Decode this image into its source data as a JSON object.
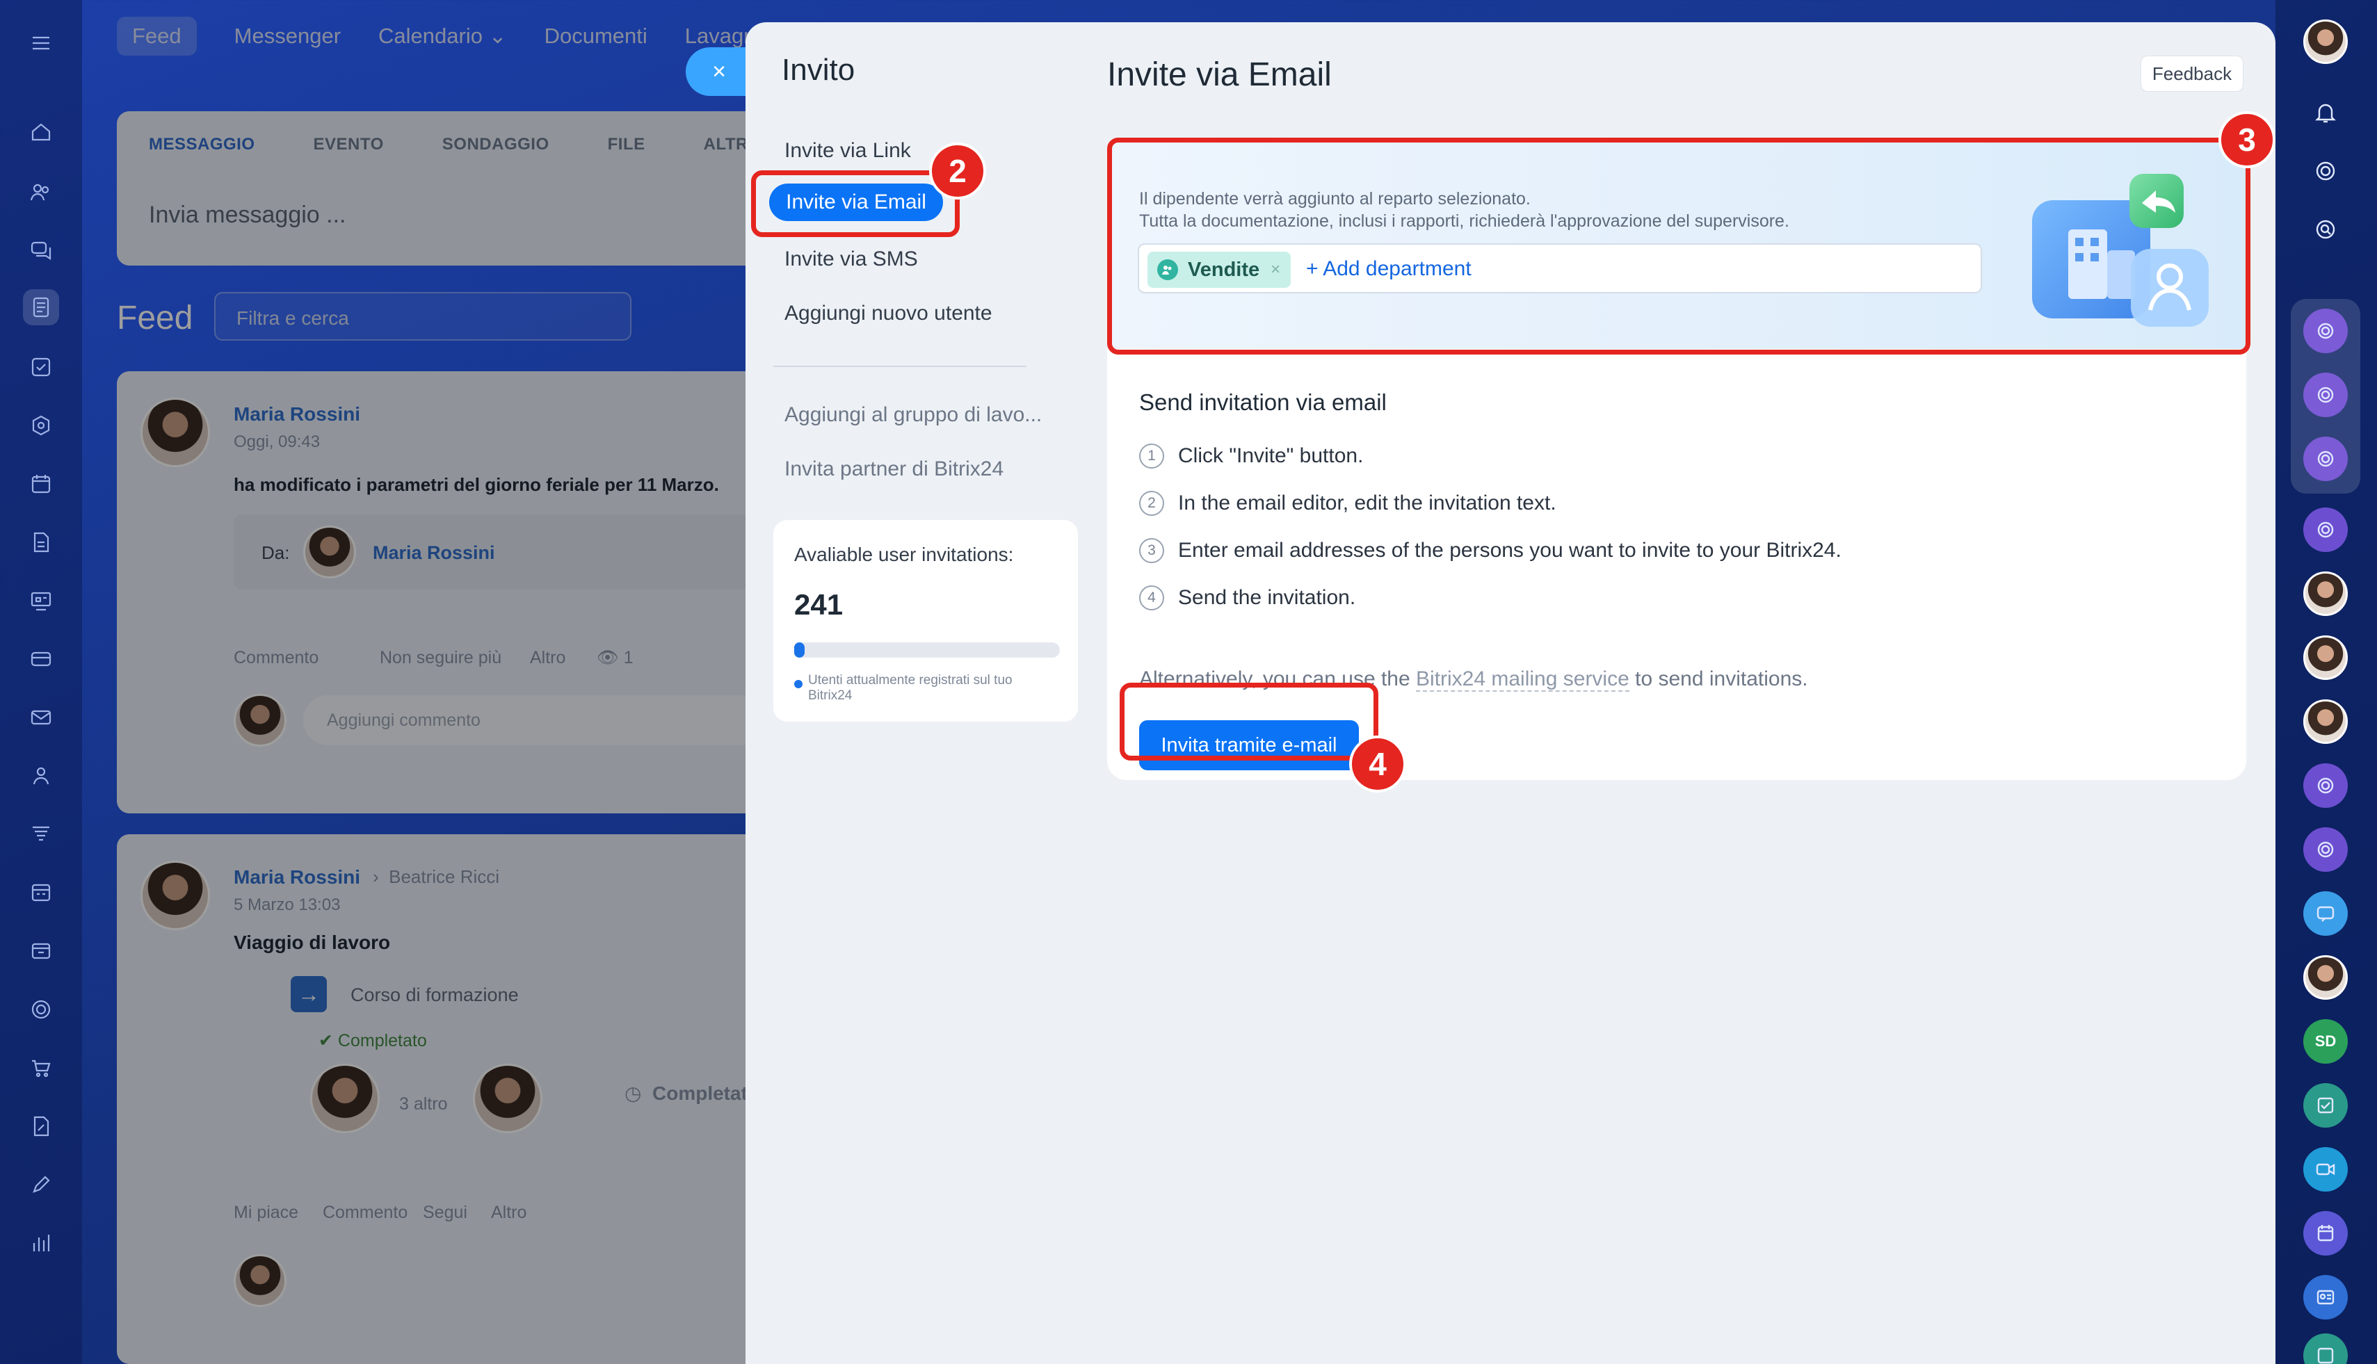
{
  "background_app": {
    "nav": [
      "Feed",
      "Messenger",
      "Calendario",
      "Documenti",
      "Lavagne"
    ],
    "composer_tabs": [
      "MESSAGGIO",
      "EVENTO",
      "SONDAGGIO",
      "FILE",
      "ALTRO"
    ],
    "composer_placeholder": "Invia messaggio ...",
    "feed_title": "Feed",
    "search_placeholder": "Filtra e cerca",
    "post1": {
      "author": "Maria Rossini",
      "time": "Oggi, 09:43",
      "text": "ha modificato i parametri del giorno feriale per 11 Marzo.",
      "from_label": "Da:",
      "from_name": "Maria Rossini",
      "actions": [
        "Commento",
        "Non seguire più",
        "Altro",
        "1"
      ],
      "comment_placeholder": "Aggiungi commento"
    },
    "post2": {
      "author": "Maria Rossini",
      "recipient": "Beatrice Ricci",
      "time": "5 Marzo 13:03",
      "title": "Viaggio di lavoro",
      "task": "Corso di formazione",
      "status": "Completato",
      "more": "3 altro",
      "status2": "Completato",
      "actions": [
        "Mi piace",
        "Commento",
        "Segui",
        "Altro"
      ]
    }
  },
  "modal": {
    "close_symbol": "×",
    "sidebar_title": "Invito",
    "menu": [
      "Invite via Link",
      "Invite via Email",
      "Invite via SMS",
      "Aggiungi nuovo utente"
    ],
    "menu_secondary": [
      "Aggiungi al gruppo di lavo...",
      "Invita partner di Bitrix24"
    ],
    "invitations": {
      "label": "Avaliable user invitations:",
      "count": "241",
      "progress_fraction": 0.04,
      "note": "Utenti attualmente registrati sul tuo Bitrix24"
    },
    "title": "Invite via Email",
    "feedback": "Feedback",
    "department": {
      "line1": "Il dipendente verrà aggiunto al reparto selezionato.",
      "line2": "Tutta la documentazione, inclusi i rapporti, richiederà l'approvazione del supervisore.",
      "tag": "Vendite",
      "tag_remove": "×",
      "add": "+ Add department"
    },
    "instructions": {
      "title": "Send invitation via email",
      "steps": [
        {
          "num": "1",
          "text": "Click \"Invite\" button."
        },
        {
          "num": "2",
          "text": "In the email editor, edit the invitation text."
        },
        {
          "num": "3",
          "text": "Enter email addresses of the persons you want to invite to your Bitrix24."
        },
        {
          "num": "4",
          "text": "Send the invitation."
        }
      ],
      "alt_prefix": "Alternatively, you can use the",
      "alt_link": "Bitrix24 mailing service",
      "alt_suffix": "to send invitations.",
      "button": "Invita tramite e-mail"
    }
  },
  "annotations": [
    "2",
    "3",
    "4"
  ],
  "right_rail": {
    "sd_label": "SD"
  },
  "colors": {
    "accent": "#0b73f5",
    "annotation": "#e5251f",
    "tag_bg": "#c8f0e9"
  }
}
